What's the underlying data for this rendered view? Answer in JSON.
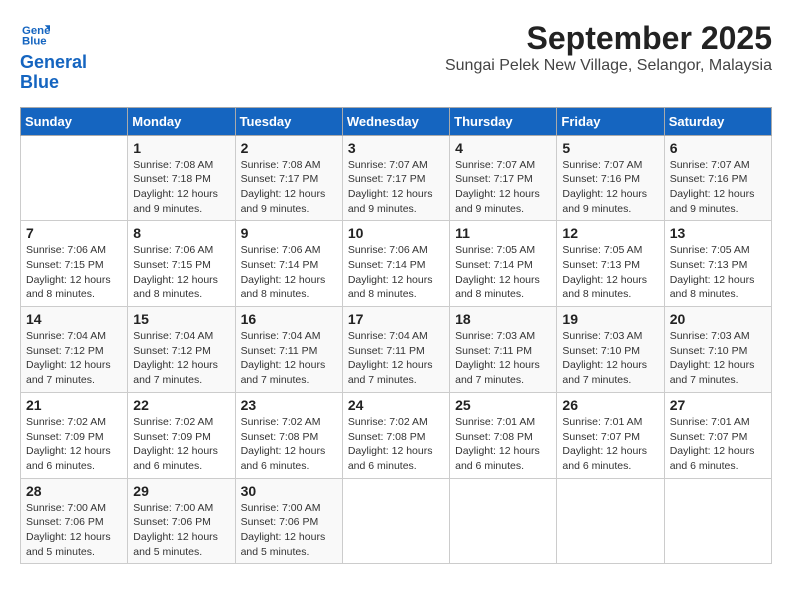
{
  "logo": {
    "line1": "General",
    "line2": "Blue"
  },
  "title": "September 2025",
  "subtitle": "Sungai Pelek New Village, Selangor, Malaysia",
  "days_of_week": [
    "Sunday",
    "Monday",
    "Tuesday",
    "Wednesday",
    "Thursday",
    "Friday",
    "Saturday"
  ],
  "weeks": [
    [
      {
        "day": "",
        "info": ""
      },
      {
        "day": "1",
        "info": "Sunrise: 7:08 AM\nSunset: 7:18 PM\nDaylight: 12 hours\nand 9 minutes."
      },
      {
        "day": "2",
        "info": "Sunrise: 7:08 AM\nSunset: 7:17 PM\nDaylight: 12 hours\nand 9 minutes."
      },
      {
        "day": "3",
        "info": "Sunrise: 7:07 AM\nSunset: 7:17 PM\nDaylight: 12 hours\nand 9 minutes."
      },
      {
        "day": "4",
        "info": "Sunrise: 7:07 AM\nSunset: 7:17 PM\nDaylight: 12 hours\nand 9 minutes."
      },
      {
        "day": "5",
        "info": "Sunrise: 7:07 AM\nSunset: 7:16 PM\nDaylight: 12 hours\nand 9 minutes."
      },
      {
        "day": "6",
        "info": "Sunrise: 7:07 AM\nSunset: 7:16 PM\nDaylight: 12 hours\nand 9 minutes."
      }
    ],
    [
      {
        "day": "7",
        "info": "Sunrise: 7:06 AM\nSunset: 7:15 PM\nDaylight: 12 hours\nand 8 minutes."
      },
      {
        "day": "8",
        "info": "Sunrise: 7:06 AM\nSunset: 7:15 PM\nDaylight: 12 hours\nand 8 minutes."
      },
      {
        "day": "9",
        "info": "Sunrise: 7:06 AM\nSunset: 7:14 PM\nDaylight: 12 hours\nand 8 minutes."
      },
      {
        "day": "10",
        "info": "Sunrise: 7:06 AM\nSunset: 7:14 PM\nDaylight: 12 hours\nand 8 minutes."
      },
      {
        "day": "11",
        "info": "Sunrise: 7:05 AM\nSunset: 7:14 PM\nDaylight: 12 hours\nand 8 minutes."
      },
      {
        "day": "12",
        "info": "Sunrise: 7:05 AM\nSunset: 7:13 PM\nDaylight: 12 hours\nand 8 minutes."
      },
      {
        "day": "13",
        "info": "Sunrise: 7:05 AM\nSunset: 7:13 PM\nDaylight: 12 hours\nand 8 minutes."
      }
    ],
    [
      {
        "day": "14",
        "info": "Sunrise: 7:04 AM\nSunset: 7:12 PM\nDaylight: 12 hours\nand 7 minutes."
      },
      {
        "day": "15",
        "info": "Sunrise: 7:04 AM\nSunset: 7:12 PM\nDaylight: 12 hours\nand 7 minutes."
      },
      {
        "day": "16",
        "info": "Sunrise: 7:04 AM\nSunset: 7:11 PM\nDaylight: 12 hours\nand 7 minutes."
      },
      {
        "day": "17",
        "info": "Sunrise: 7:04 AM\nSunset: 7:11 PM\nDaylight: 12 hours\nand 7 minutes."
      },
      {
        "day": "18",
        "info": "Sunrise: 7:03 AM\nSunset: 7:11 PM\nDaylight: 12 hours\nand 7 minutes."
      },
      {
        "day": "19",
        "info": "Sunrise: 7:03 AM\nSunset: 7:10 PM\nDaylight: 12 hours\nand 7 minutes."
      },
      {
        "day": "20",
        "info": "Sunrise: 7:03 AM\nSunset: 7:10 PM\nDaylight: 12 hours\nand 7 minutes."
      }
    ],
    [
      {
        "day": "21",
        "info": "Sunrise: 7:02 AM\nSunset: 7:09 PM\nDaylight: 12 hours\nand 6 minutes."
      },
      {
        "day": "22",
        "info": "Sunrise: 7:02 AM\nSunset: 7:09 PM\nDaylight: 12 hours\nand 6 minutes."
      },
      {
        "day": "23",
        "info": "Sunrise: 7:02 AM\nSunset: 7:08 PM\nDaylight: 12 hours\nand 6 minutes."
      },
      {
        "day": "24",
        "info": "Sunrise: 7:02 AM\nSunset: 7:08 PM\nDaylight: 12 hours\nand 6 minutes."
      },
      {
        "day": "25",
        "info": "Sunrise: 7:01 AM\nSunset: 7:08 PM\nDaylight: 12 hours\nand 6 minutes."
      },
      {
        "day": "26",
        "info": "Sunrise: 7:01 AM\nSunset: 7:07 PM\nDaylight: 12 hours\nand 6 minutes."
      },
      {
        "day": "27",
        "info": "Sunrise: 7:01 AM\nSunset: 7:07 PM\nDaylight: 12 hours\nand 6 minutes."
      }
    ],
    [
      {
        "day": "28",
        "info": "Sunrise: 7:00 AM\nSunset: 7:06 PM\nDaylight: 12 hours\nand 5 minutes."
      },
      {
        "day": "29",
        "info": "Sunrise: 7:00 AM\nSunset: 7:06 PM\nDaylight: 12 hours\nand 5 minutes."
      },
      {
        "day": "30",
        "info": "Sunrise: 7:00 AM\nSunset: 7:06 PM\nDaylight: 12 hours\nand 5 minutes."
      },
      {
        "day": "",
        "info": ""
      },
      {
        "day": "",
        "info": ""
      },
      {
        "day": "",
        "info": ""
      },
      {
        "day": "",
        "info": ""
      }
    ]
  ]
}
